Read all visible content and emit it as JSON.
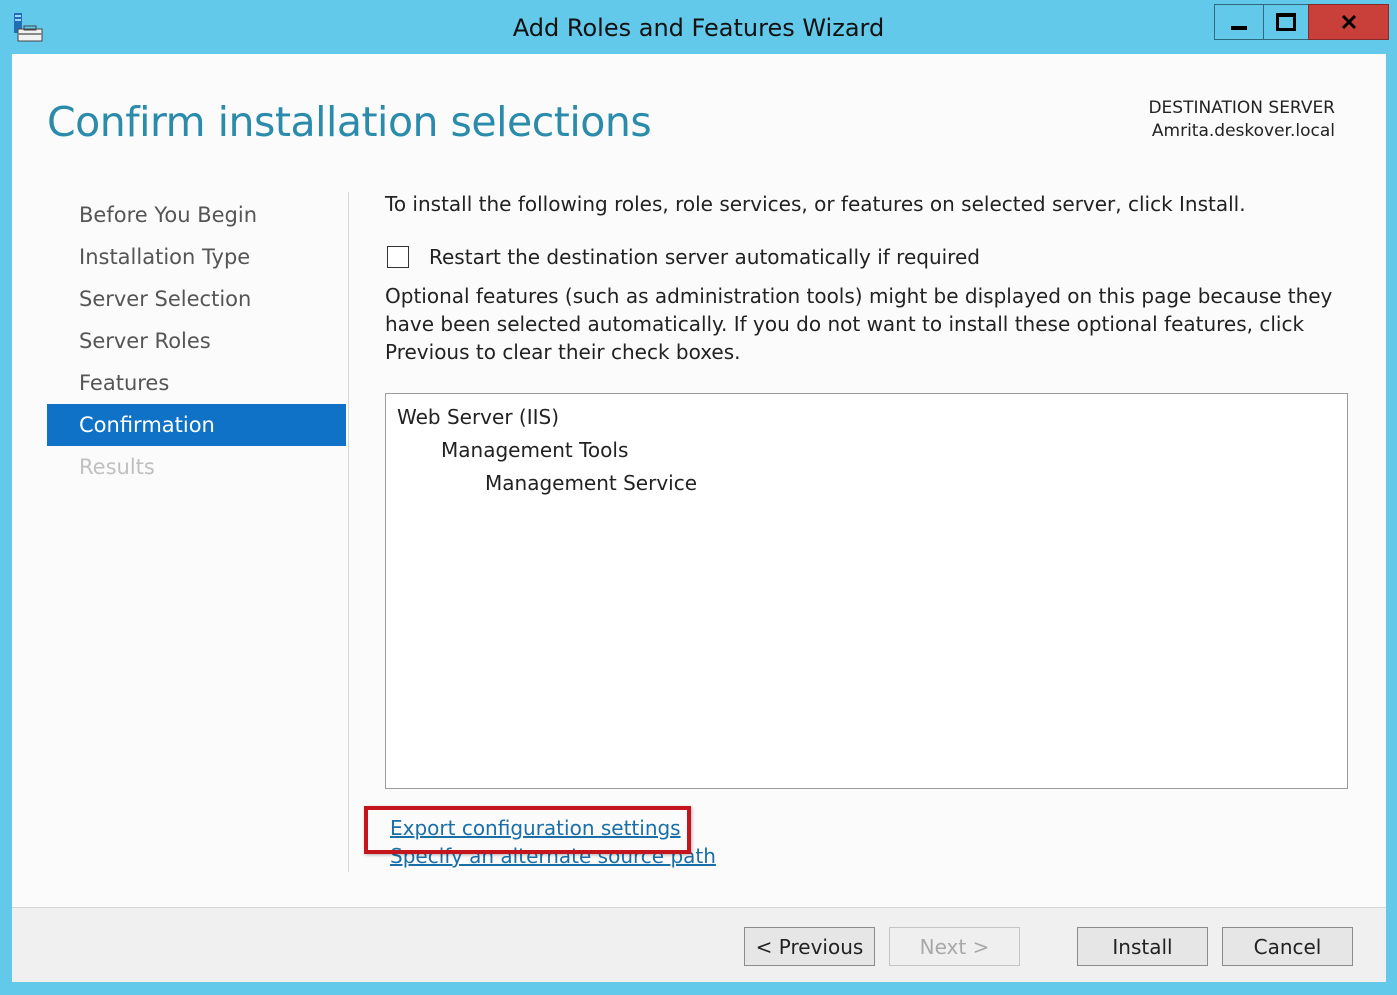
{
  "window": {
    "title": "Add Roles and Features Wizard",
    "app_icon": "server-manager-icon",
    "controls": {
      "minimize": "minimize-icon",
      "maximize": "maximize-icon",
      "close": "close-icon"
    }
  },
  "header": {
    "page_title": "Confirm installation selections",
    "destination_label": "DESTINATION SERVER",
    "destination_value": "Amrita.deskover.local"
  },
  "nav": {
    "items": [
      {
        "label": "Before You Begin",
        "state": "normal"
      },
      {
        "label": "Installation Type",
        "state": "normal"
      },
      {
        "label": "Server Selection",
        "state": "normal"
      },
      {
        "label": "Server Roles",
        "state": "normal"
      },
      {
        "label": "Features",
        "state": "normal"
      },
      {
        "label": "Confirmation",
        "state": "active"
      },
      {
        "label": "Results",
        "state": "disabled"
      }
    ]
  },
  "main": {
    "intro": "To install the following roles, role services, or features on selected server, click Install.",
    "restart_label": "Restart the destination server automatically if required",
    "restart_checked": false,
    "optional_text": "Optional features (such as administration tools) might be displayed on this page because they have been selected automatically. If you do not want to install these optional features, click Previous to clear their check boxes.",
    "selections": [
      {
        "label": "Web Server (IIS)",
        "level": 0
      },
      {
        "label": "Management Tools",
        "level": 1
      },
      {
        "label": "Management Service",
        "level": 2
      }
    ],
    "export_link": "Export configuration settings",
    "alternate_source_link": "Specify an alternate source path"
  },
  "footer": {
    "previous_label": "< Previous",
    "next_label": "Next >",
    "install_label": "Install",
    "cancel_label": "Cancel"
  },
  "colors": {
    "frame": "#63c9ea",
    "accent_title": "#2a8bab",
    "nav_active": "#0f72c6",
    "close_button": "#c9403a",
    "highlight_box": "#c4141c",
    "link": "#1a6fa8"
  }
}
